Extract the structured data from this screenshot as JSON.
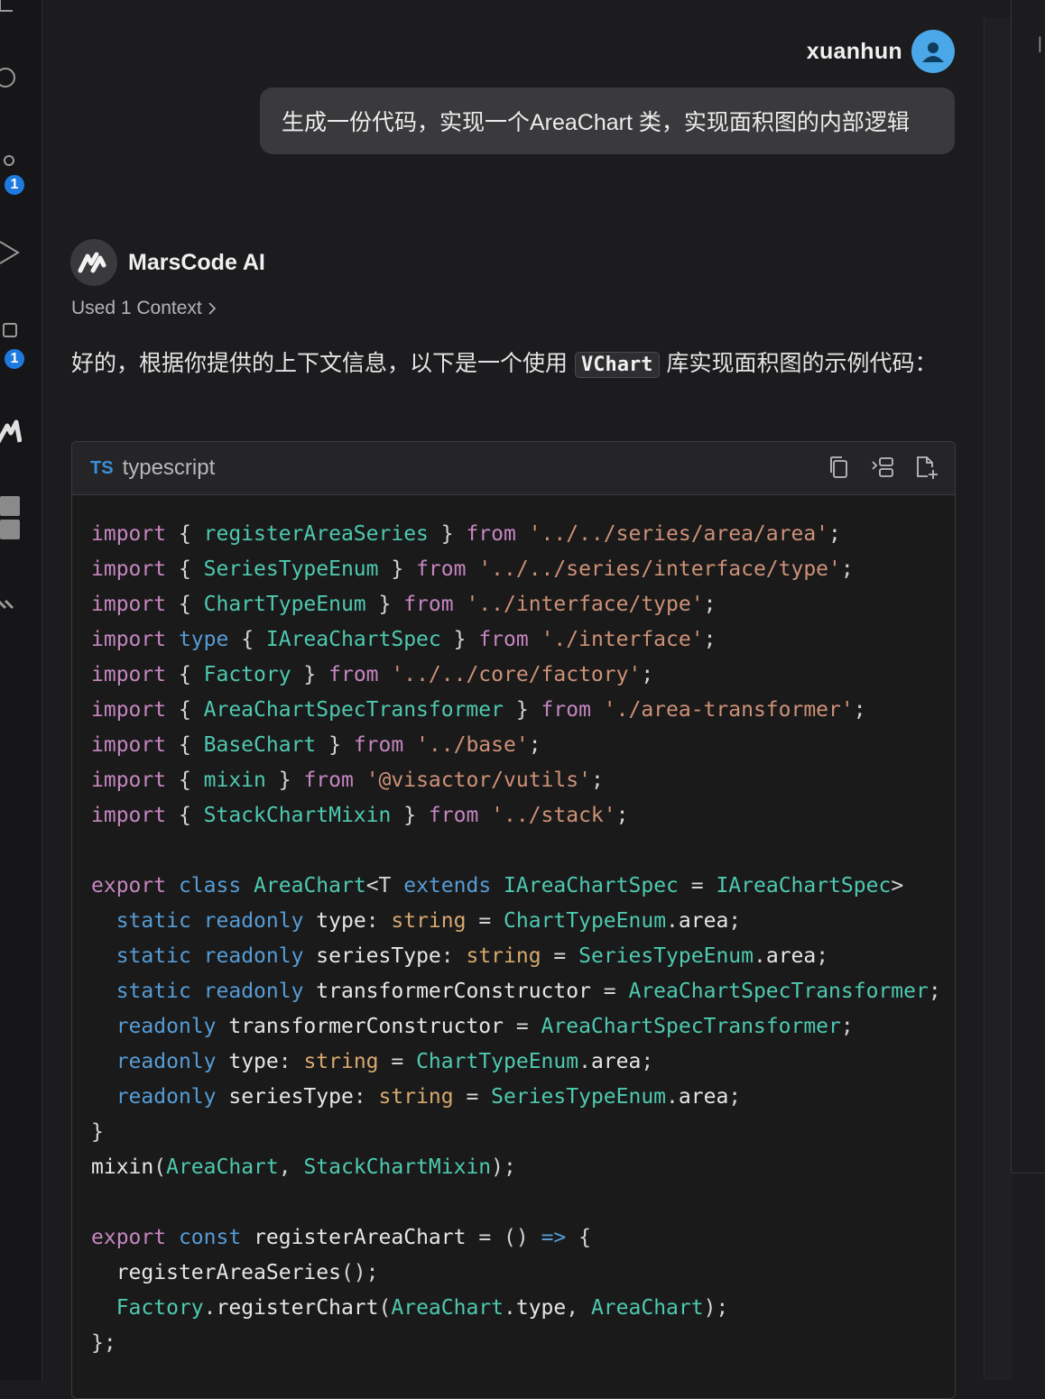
{
  "activity_bar": {
    "badge_scm": "1",
    "badge_ext": "1"
  },
  "user_message": {
    "username": "xuanhun",
    "text": "生成一份代码，实现一个AreaChart 类，实现面积图的内部逻辑"
  },
  "ai_message": {
    "name": "MarsCode AI",
    "context_label": "Used 1 Context",
    "reply_prefix": "好的，根据你提供的上下文信息，以下是一个使用",
    "reply_code": "VChart",
    "reply_suffix": "库实现面积图的示例代码："
  },
  "code_block": {
    "lang_badge": "TS",
    "lang_name": "typescript",
    "lines": [
      [
        [
          "kw",
          "import"
        ],
        [
          "p",
          " { "
        ],
        [
          "type",
          "registerAreaSeries"
        ],
        [
          "p",
          " } "
        ],
        [
          "kw",
          "from"
        ],
        [
          "p",
          " "
        ],
        [
          "str",
          "'../../series/area/area'"
        ],
        [
          "p",
          ";"
        ]
      ],
      [
        [
          "kw",
          "import"
        ],
        [
          "p",
          " { "
        ],
        [
          "type",
          "SeriesTypeEnum"
        ],
        [
          "p",
          " } "
        ],
        [
          "kw",
          "from"
        ],
        [
          "p",
          " "
        ],
        [
          "str",
          "'../../series/interface/type'"
        ],
        [
          "p",
          ";"
        ]
      ],
      [
        [
          "kw",
          "import"
        ],
        [
          "p",
          " { "
        ],
        [
          "type",
          "ChartTypeEnum"
        ],
        [
          "p",
          " } "
        ],
        [
          "kw",
          "from"
        ],
        [
          "p",
          " "
        ],
        [
          "str",
          "'../interface/type'"
        ],
        [
          "p",
          ";"
        ]
      ],
      [
        [
          "kw",
          "import"
        ],
        [
          "p",
          " "
        ],
        [
          "kw2",
          "type"
        ],
        [
          "p",
          " { "
        ],
        [
          "type",
          "IAreaChartSpec"
        ],
        [
          "p",
          " } "
        ],
        [
          "kw",
          "from"
        ],
        [
          "p",
          " "
        ],
        [
          "str",
          "'./interface'"
        ],
        [
          "p",
          ";"
        ]
      ],
      [
        [
          "kw",
          "import"
        ],
        [
          "p",
          " { "
        ],
        [
          "type",
          "Factory"
        ],
        [
          "p",
          " } "
        ],
        [
          "kw",
          "from"
        ],
        [
          "p",
          " "
        ],
        [
          "str",
          "'../../core/factory'"
        ],
        [
          "p",
          ";"
        ]
      ],
      [
        [
          "kw",
          "import"
        ],
        [
          "p",
          " { "
        ],
        [
          "type",
          "AreaChartSpecTransformer"
        ],
        [
          "p",
          " } "
        ],
        [
          "kw",
          "from"
        ],
        [
          "p",
          " "
        ],
        [
          "str",
          "'./area-transformer'"
        ],
        [
          "p",
          ";"
        ]
      ],
      [
        [
          "kw",
          "import"
        ],
        [
          "p",
          " { "
        ],
        [
          "type",
          "BaseChart"
        ],
        [
          "p",
          " } "
        ],
        [
          "kw",
          "from"
        ],
        [
          "p",
          " "
        ],
        [
          "str",
          "'../base'"
        ],
        [
          "p",
          ";"
        ]
      ],
      [
        [
          "kw",
          "import"
        ],
        [
          "p",
          " { "
        ],
        [
          "type",
          "mixin"
        ],
        [
          "p",
          " } "
        ],
        [
          "kw",
          "from"
        ],
        [
          "p",
          " "
        ],
        [
          "str",
          "'@visactor/vutils'"
        ],
        [
          "p",
          ";"
        ]
      ],
      [
        [
          "kw",
          "import"
        ],
        [
          "p",
          " { "
        ],
        [
          "type",
          "StackChartMixin"
        ],
        [
          "p",
          " } "
        ],
        [
          "kw",
          "from"
        ],
        [
          "p",
          " "
        ],
        [
          "str",
          "'../stack'"
        ],
        [
          "p",
          ";"
        ]
      ],
      [],
      [
        [
          "kw",
          "export"
        ],
        [
          "p",
          " "
        ],
        [
          "kw2",
          "class"
        ],
        [
          "p",
          " "
        ],
        [
          "type",
          "AreaChart"
        ],
        [
          "p",
          "<T "
        ],
        [
          "kw2",
          "extends"
        ],
        [
          "p",
          " "
        ],
        [
          "type",
          "IAreaChartSpec"
        ],
        [
          "p",
          " = "
        ],
        [
          "type",
          "IAreaChartSpec"
        ],
        [
          "p",
          "> "
        ]
      ],
      [
        [
          "p",
          "  "
        ],
        [
          "kw2",
          "static"
        ],
        [
          "p",
          " "
        ],
        [
          "kw2",
          "readonly"
        ],
        [
          "p",
          " "
        ],
        [
          "prop",
          "type"
        ],
        [
          "p",
          ": "
        ],
        [
          "ty",
          "string"
        ],
        [
          "p",
          " = "
        ],
        [
          "type",
          "ChartTypeEnum"
        ],
        [
          "p",
          "."
        ],
        [
          "prop",
          "area"
        ],
        [
          "p",
          ";"
        ]
      ],
      [
        [
          "p",
          "  "
        ],
        [
          "kw2",
          "static"
        ],
        [
          "p",
          " "
        ],
        [
          "kw2",
          "readonly"
        ],
        [
          "p",
          " "
        ],
        [
          "prop",
          "seriesType"
        ],
        [
          "p",
          ": "
        ],
        [
          "ty",
          "string"
        ],
        [
          "p",
          " = "
        ],
        [
          "type",
          "SeriesTypeEnum"
        ],
        [
          "p",
          "."
        ],
        [
          "prop",
          "area"
        ],
        [
          "p",
          ";"
        ]
      ],
      [
        [
          "p",
          "  "
        ],
        [
          "kw2",
          "static"
        ],
        [
          "p",
          " "
        ],
        [
          "kw2",
          "readonly"
        ],
        [
          "p",
          " "
        ],
        [
          "prop",
          "transformerConstructor"
        ],
        [
          "p",
          " = "
        ],
        [
          "type",
          "AreaChartSpecTransformer"
        ],
        [
          "p",
          ";"
        ]
      ],
      [
        [
          "p",
          "  "
        ],
        [
          "kw2",
          "readonly"
        ],
        [
          "p",
          " "
        ],
        [
          "prop",
          "transformerConstructor"
        ],
        [
          "p",
          " = "
        ],
        [
          "type",
          "AreaChartSpecTransformer"
        ],
        [
          "p",
          ";"
        ]
      ],
      [
        [
          "p",
          "  "
        ],
        [
          "kw2",
          "readonly"
        ],
        [
          "p",
          " "
        ],
        [
          "prop",
          "type"
        ],
        [
          "p",
          ": "
        ],
        [
          "ty",
          "string"
        ],
        [
          "p",
          " = "
        ],
        [
          "type",
          "ChartTypeEnum"
        ],
        [
          "p",
          "."
        ],
        [
          "prop",
          "area"
        ],
        [
          "p",
          ";"
        ]
      ],
      [
        [
          "p",
          "  "
        ],
        [
          "kw2",
          "readonly"
        ],
        [
          "p",
          " "
        ],
        [
          "prop",
          "seriesType"
        ],
        [
          "p",
          ": "
        ],
        [
          "ty",
          "string"
        ],
        [
          "p",
          " = "
        ],
        [
          "type",
          "SeriesTypeEnum"
        ],
        [
          "p",
          "."
        ],
        [
          "prop",
          "area"
        ],
        [
          "p",
          ";"
        ]
      ],
      [
        [
          "p",
          "}"
        ]
      ],
      [
        [
          "prop",
          "mixin"
        ],
        [
          "p",
          "("
        ],
        [
          "type",
          "AreaChart"
        ],
        [
          "p",
          ", "
        ],
        [
          "type",
          "StackChartMixin"
        ],
        [
          "p",
          ");"
        ]
      ],
      [],
      [
        [
          "kw",
          "export"
        ],
        [
          "p",
          " "
        ],
        [
          "kw2",
          "const"
        ],
        [
          "p",
          " "
        ],
        [
          "prop",
          "registerAreaChart"
        ],
        [
          "p",
          " = () "
        ],
        [
          "kw2",
          "=>"
        ],
        [
          "p",
          " {"
        ]
      ],
      [
        [
          "p",
          "  "
        ],
        [
          "prop",
          "registerAreaSeries"
        ],
        [
          "p",
          "();"
        ]
      ],
      [
        [
          "p",
          "  "
        ],
        [
          "type",
          "Factory"
        ],
        [
          "p",
          "."
        ],
        [
          "prop",
          "registerChart"
        ],
        [
          "p",
          "("
        ],
        [
          "type",
          "AreaChart"
        ],
        [
          "p",
          "."
        ],
        [
          "prop",
          "type"
        ],
        [
          "p",
          ", "
        ],
        [
          "type",
          "AreaChart"
        ],
        [
          "p",
          ");"
        ]
      ],
      [
        [
          "p",
          "};"
        ]
      ]
    ]
  }
}
